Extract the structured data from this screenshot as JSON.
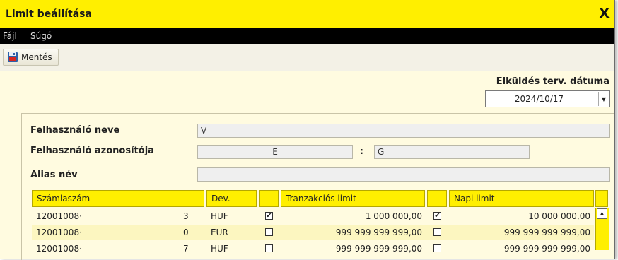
{
  "window": {
    "title": "Limit beállítása",
    "close_glyph": "X"
  },
  "menu": {
    "file": "Fájl",
    "help": "Súgó"
  },
  "toolbar": {
    "save_label": "Mentés",
    "save_icon": "floppy-disk-icon"
  },
  "send_date": {
    "label": "Elküldés terv. dátuma",
    "value": "2024/10/17"
  },
  "form": {
    "username_label": "Felhasználó neve",
    "username_value": "V",
    "userid_label": "Felhasználó azonosítója",
    "userid_part1": "E",
    "userid_sep": ":",
    "userid_part2": "G",
    "alias_label": "Alias név",
    "alias_value": ""
  },
  "table": {
    "headers": {
      "account": "Számlaszám",
      "currency": "Dev.",
      "tx_limit": "Tranzakciós limit",
      "daily_limit": "Napi limit"
    },
    "rows": [
      {
        "account": "12001008·",
        "suffix": "3",
        "currency": "HUF",
        "tx_checked": true,
        "tx_limit": "1 000 000,00",
        "daily_checked": true,
        "daily_limit": "10 000 000,00"
      },
      {
        "account": "12001008·",
        "suffix": "0",
        "currency": "EUR",
        "tx_checked": false,
        "tx_limit": "999 999 999 999,00",
        "daily_checked": false,
        "daily_limit": "999 999 999 999,00"
      },
      {
        "account": "12001008·",
        "suffix": "7",
        "currency": "HUF",
        "tx_checked": false,
        "tx_limit": "999 999 999 999,00",
        "daily_checked": false,
        "daily_limit": "999 999 999 999,00"
      }
    ]
  },
  "colors": {
    "accent_yellow": "#ffef00",
    "menubar_black": "#000000",
    "row_alt": "#fcf6c0"
  }
}
